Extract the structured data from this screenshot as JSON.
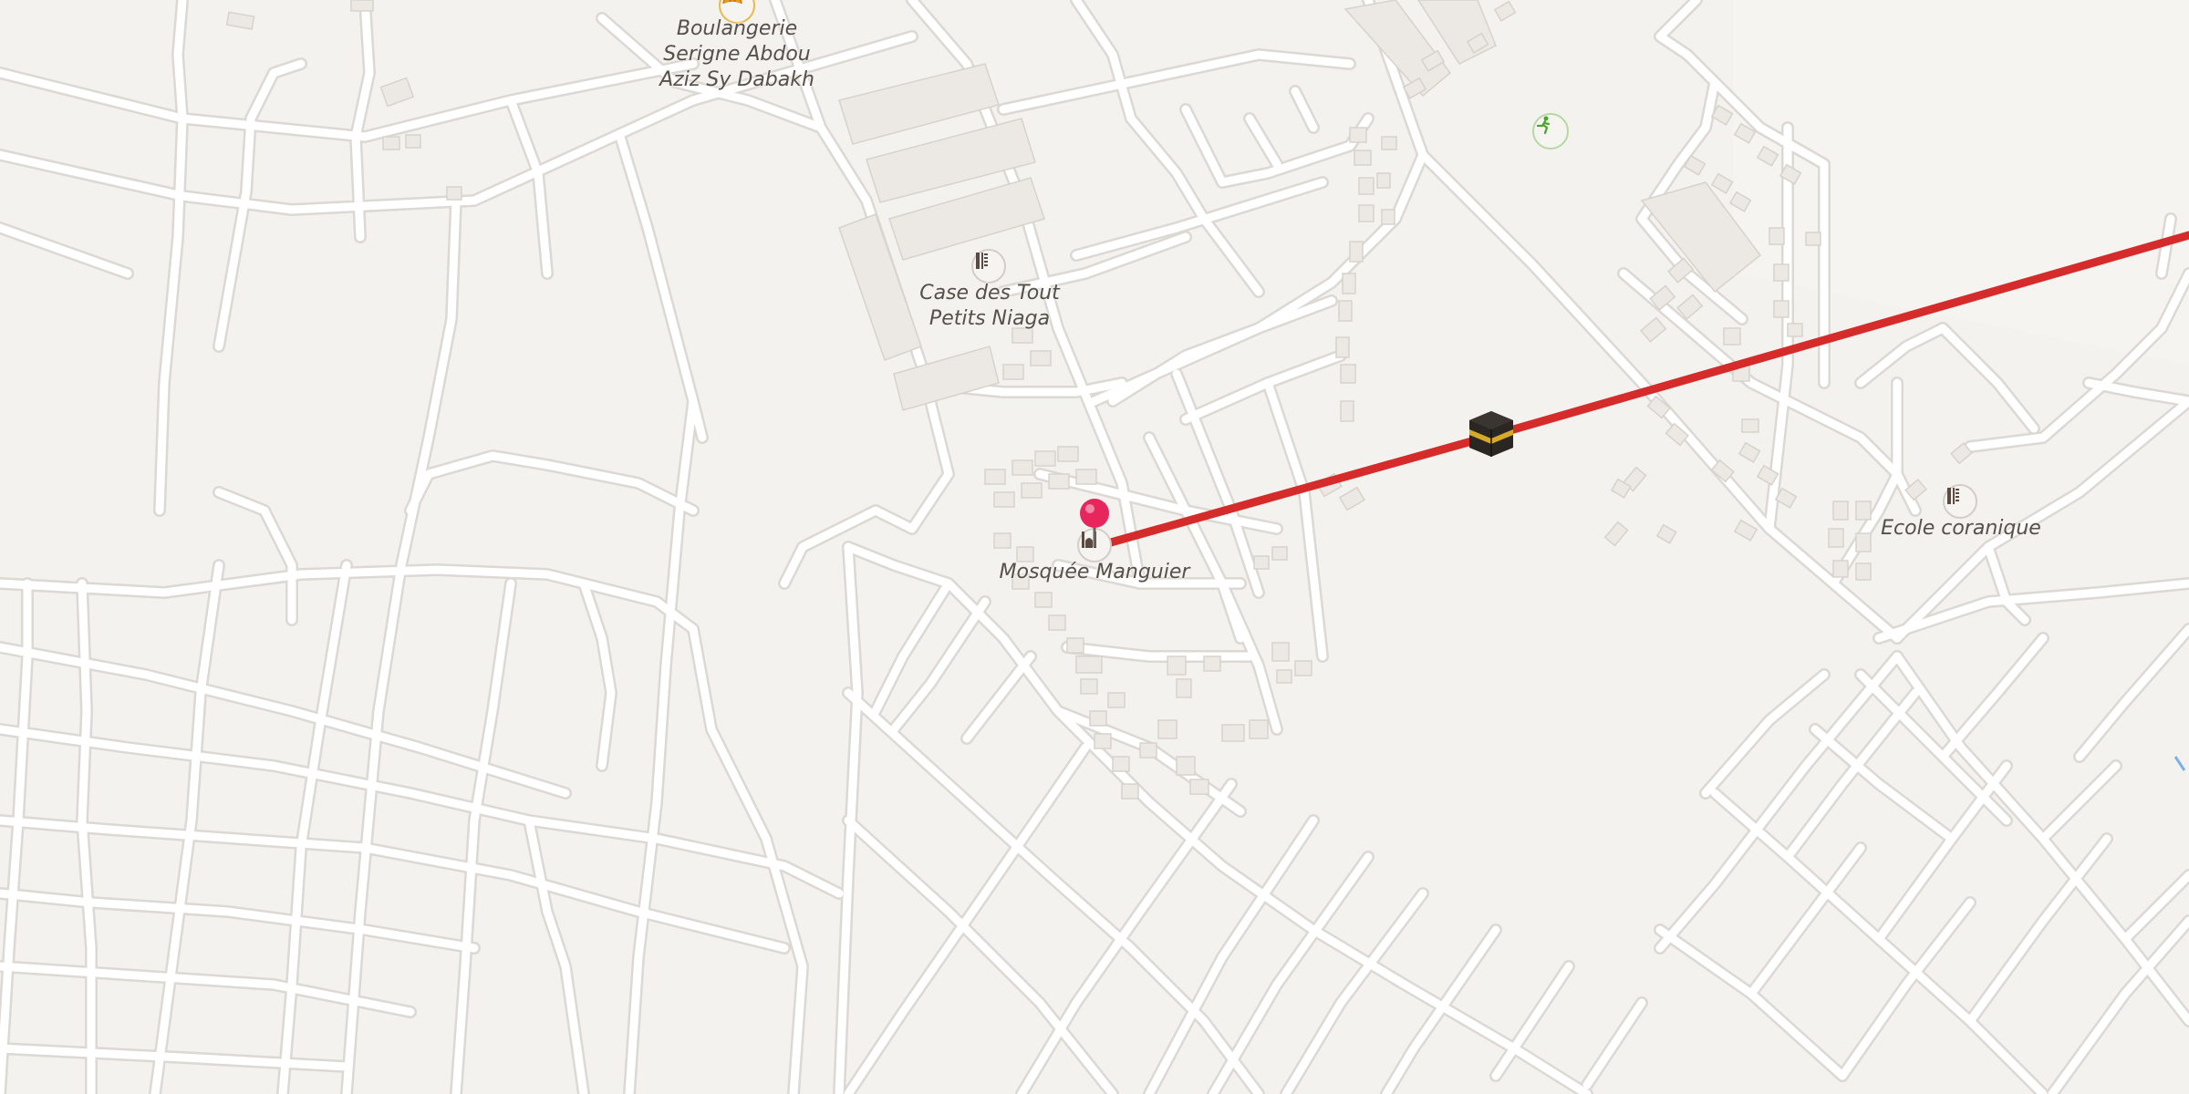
{
  "map": {
    "background_color": "#f4f2ef",
    "road_color": "#ffffff",
    "road_casing_color": "#dedad5",
    "building_color": "#ece8e3",
    "building_outline_color": "#d8d2cb",
    "route_color": "#d62b2b",
    "marker_color": "#e8265e"
  },
  "labels": {
    "boulangerie": [
      "Boulangerie",
      "Serigne Abdou",
      "Aziz Sy Dabakh"
    ],
    "case_des_tout": [
      "Case des Tout",
      "Petits Niaga"
    ],
    "mosquee": "Mosquée Manguier",
    "ecole": "Ecole coranique"
  },
  "icons": {
    "boulangerie": "bakery-icon",
    "case_des_tout": "school-icon",
    "mosquee": "mosque-icon",
    "ecole": "school-icon",
    "kaaba": "kaaba-icon",
    "sports": "sports-pitch-icon",
    "marker": "location-pin-icon"
  }
}
